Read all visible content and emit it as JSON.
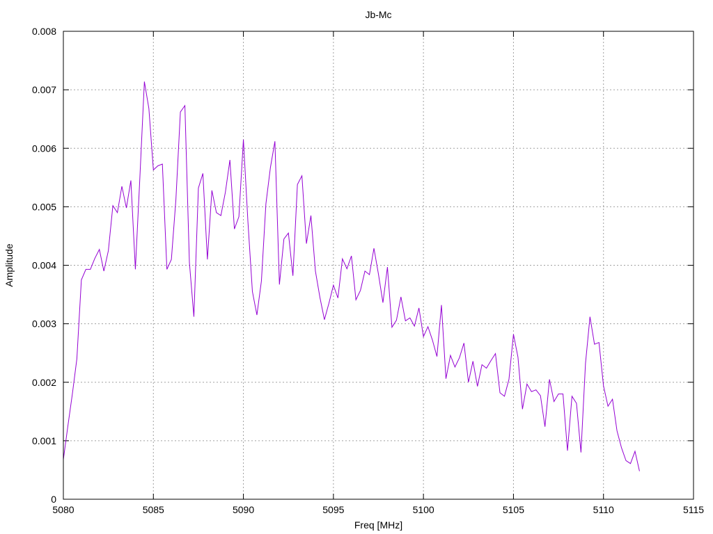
{
  "chart_data": {
    "type": "line",
    "title": "Jb-Mc",
    "xlabel": "Freq [MHz]",
    "ylabel": "Amplitude",
    "xlim": [
      5080,
      5115
    ],
    "ylim": [
      0,
      0.008
    ],
    "xticks": [
      5080,
      5085,
      5090,
      5095,
      5100,
      5105,
      5110,
      5115
    ],
    "yticks": [
      0,
      0.001,
      0.002,
      0.003,
      0.004,
      0.005,
      0.006,
      0.007,
      0.008
    ],
    "xtick_labels": [
      "5080",
      "5085",
      "5090",
      "5095",
      "5100",
      "5105",
      "5110",
      "5115"
    ],
    "ytick_labels": [
      "0",
      "0.001",
      "0.002",
      "0.003",
      "0.004",
      "0.005",
      "0.006",
      "0.007",
      "0.008"
    ],
    "grid": true,
    "line_color": "#9400d3",
    "series": [
      {
        "x": [
          5080.0,
          5080.25,
          5080.5,
          5080.75,
          5081.0,
          5081.25,
          5081.5,
          5081.75,
          5082.0,
          5082.25,
          5082.5,
          5082.75,
          5083.0,
          5083.25,
          5083.5,
          5083.75,
          5084.0,
          5084.25,
          5084.5,
          5084.75,
          5085.0,
          5085.25,
          5085.5,
          5085.75,
          5086.0,
          5086.25,
          5086.5,
          5086.75,
          5087.0,
          5087.25,
          5087.5,
          5087.75,
          5088.0,
          5088.25,
          5088.5,
          5088.75,
          5089.0,
          5089.25,
          5089.5,
          5089.75,
          5090.0,
          5090.25,
          5090.5,
          5090.75,
          5091.0,
          5091.25,
          5091.5,
          5091.75,
          5092.0,
          5092.25,
          5092.5,
          5092.75,
          5093.0,
          5093.25,
          5093.5,
          5093.75,
          5094.0,
          5094.25,
          5094.5,
          5094.75,
          5095.0,
          5095.25,
          5095.5,
          5095.75,
          5096.0,
          5096.25,
          5096.5,
          5096.75,
          5097.0,
          5097.25,
          5097.5,
          5097.75,
          5098.0,
          5098.25,
          5098.5,
          5098.75,
          5099.0,
          5099.25,
          5099.5,
          5099.75,
          5100.0,
          5100.25,
          5100.5,
          5100.75,
          5101.0,
          5101.25,
          5101.5,
          5101.75,
          5102.0,
          5102.25,
          5102.5,
          5102.75,
          5103.0,
          5103.25,
          5103.5,
          5103.75,
          5104.0,
          5104.25,
          5104.5,
          5104.75,
          5105.0,
          5105.25,
          5105.5,
          5105.75,
          5106.0,
          5106.25,
          5106.5,
          5106.75,
          5107.0,
          5107.25,
          5107.5,
          5107.75,
          5108.0,
          5108.25,
          5108.5,
          5108.75,
          5109.0,
          5109.25,
          5109.5,
          5109.75,
          5110.0,
          5110.25,
          5110.5,
          5110.75,
          5111.0,
          5111.25,
          5111.5,
          5111.75,
          5112.0
        ],
        "y": [
          0.00068,
          0.00125,
          0.0018,
          0.0024,
          0.00375,
          0.00393,
          0.00393,
          0.00412,
          0.00427,
          0.0039,
          0.00425,
          0.00502,
          0.0049,
          0.00535,
          0.00498,
          0.00545,
          0.00393,
          0.0055,
          0.00714,
          0.00668,
          0.00563,
          0.0057,
          0.00573,
          0.00393,
          0.0041,
          0.00512,
          0.00662,
          0.00673,
          0.00405,
          0.00312,
          0.00532,
          0.00557,
          0.0041,
          0.00528,
          0.0049,
          0.00485,
          0.00525,
          0.0058,
          0.00462,
          0.00483,
          0.00615,
          0.00475,
          0.00355,
          0.00315,
          0.00373,
          0.00505,
          0.00567,
          0.00612,
          0.00367,
          0.00445,
          0.00455,
          0.00382,
          0.00538,
          0.00553,
          0.00437,
          0.00485,
          0.0039,
          0.00345,
          0.00307,
          0.00335,
          0.00366,
          0.00344,
          0.00411,
          0.00394,
          0.00416,
          0.00341,
          0.00357,
          0.0039,
          0.00384,
          0.00429,
          0.00385,
          0.00336,
          0.00397,
          0.00294,
          0.00306,
          0.00346,
          0.00305,
          0.0031,
          0.00296,
          0.00327,
          0.00278,
          0.00295,
          0.00272,
          0.00244,
          0.00332,
          0.00206,
          0.00246,
          0.00226,
          0.00242,
          0.00267,
          0.002,
          0.00236,
          0.00193,
          0.0023,
          0.00224,
          0.00237,
          0.00249,
          0.00182,
          0.00176,
          0.00205,
          0.00282,
          0.00243,
          0.00154,
          0.00197,
          0.00184,
          0.00187,
          0.00177,
          0.00124,
          0.00205,
          0.00167,
          0.0018,
          0.0018,
          0.00083,
          0.00176,
          0.00164,
          0.0008,
          0.00232,
          0.00312,
          0.00265,
          0.00268,
          0.00194,
          0.00159,
          0.00171,
          0.00117,
          0.00088,
          0.00066,
          0.00061,
          0.00082,
          0.00048
        ]
      }
    ]
  }
}
